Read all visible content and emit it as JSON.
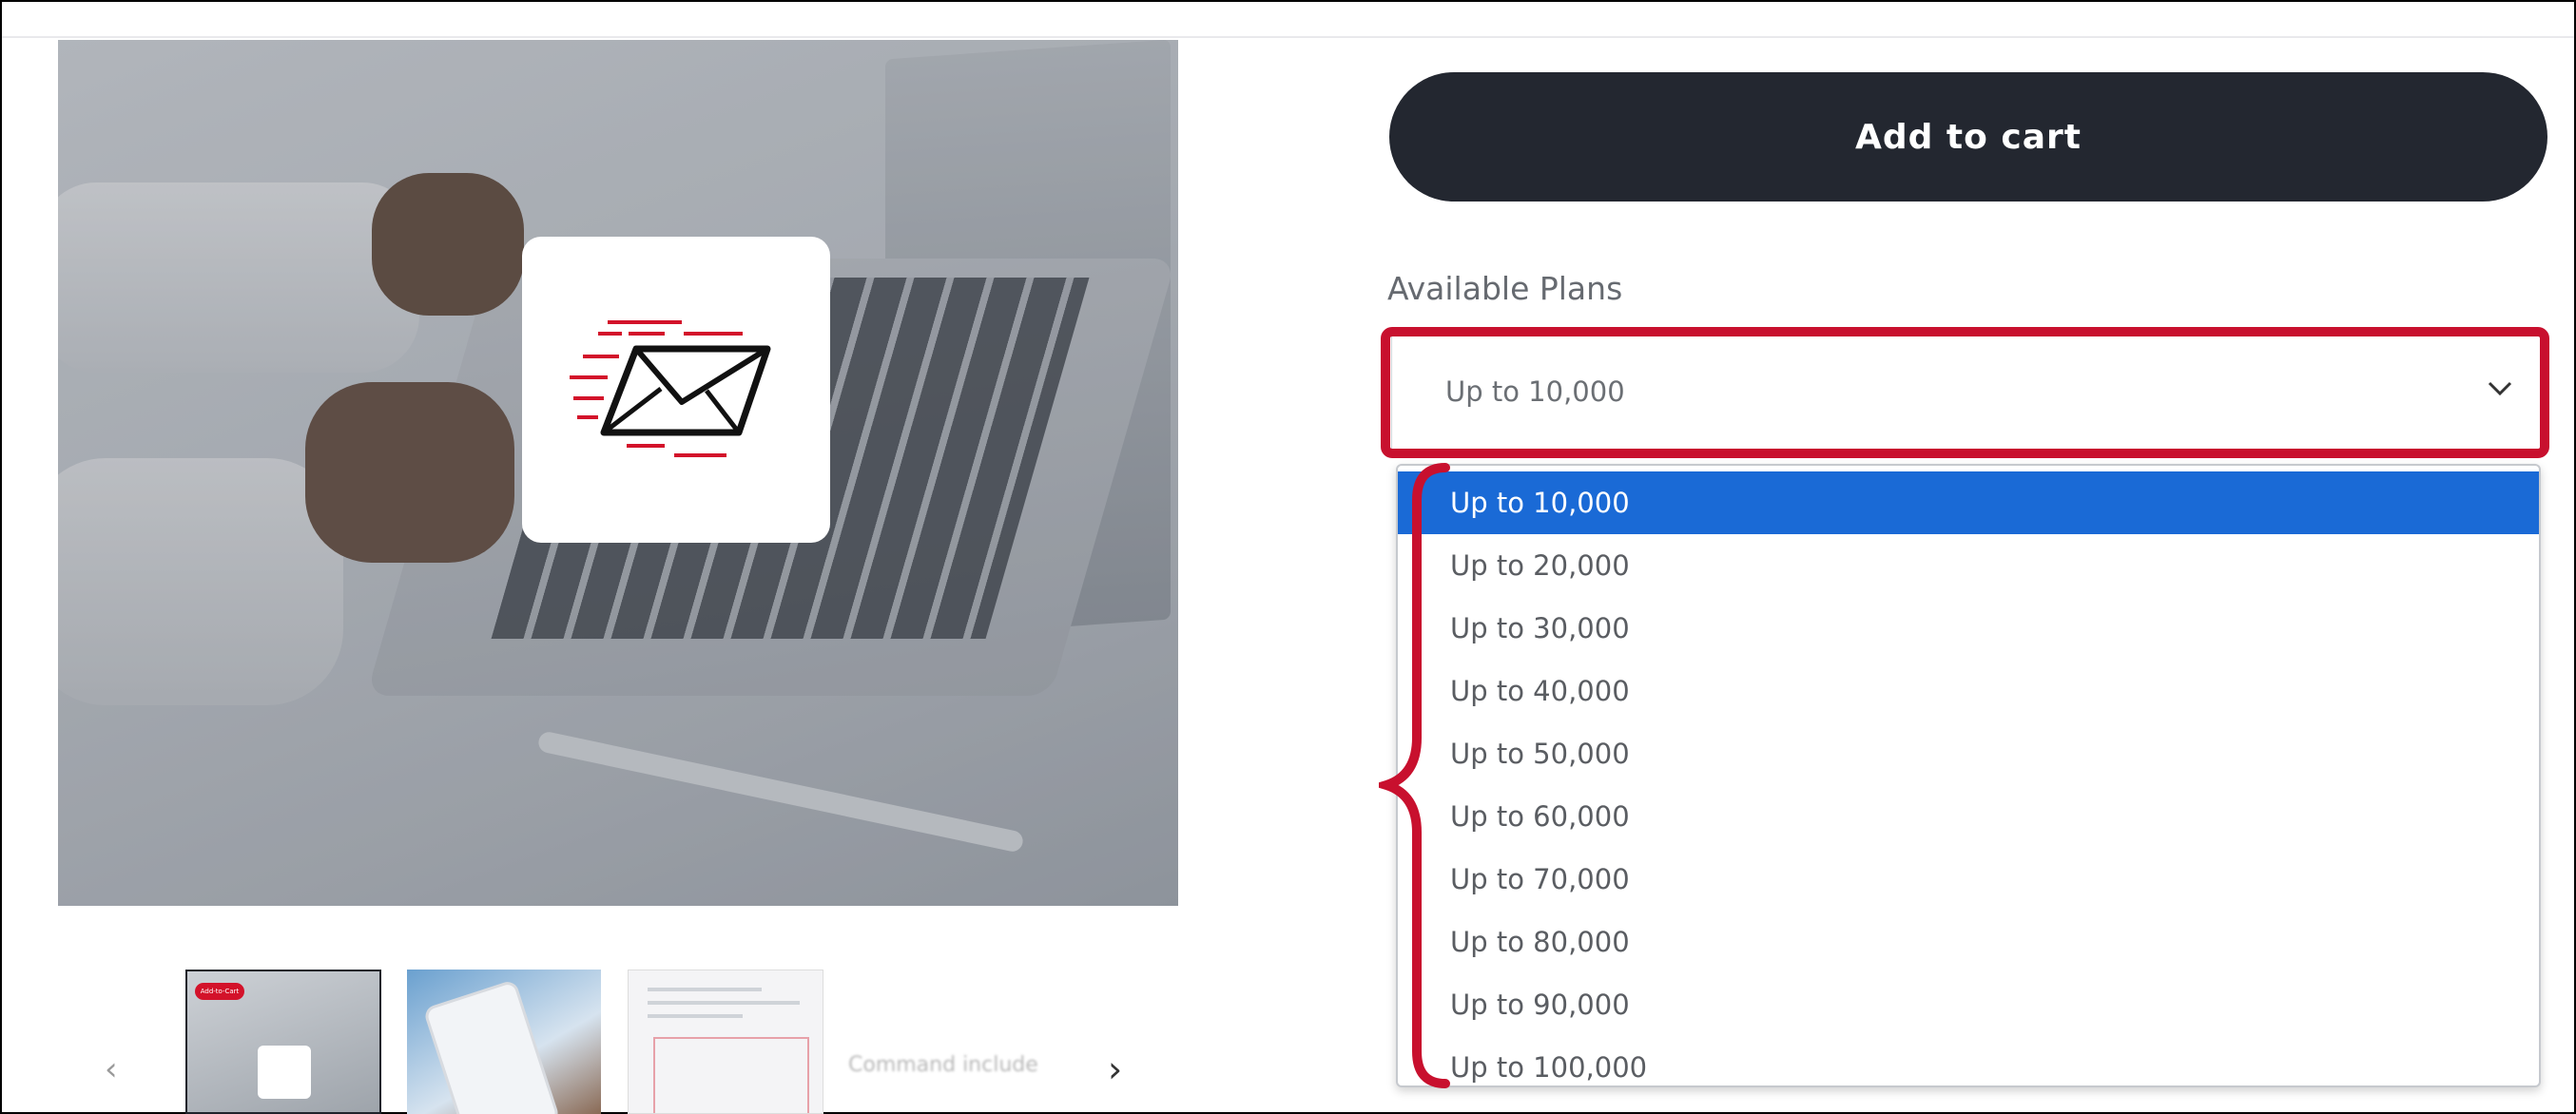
{
  "product": {
    "add_to_cart_label": "Add to cart",
    "plans_label": "Available Plans",
    "selected_plan": "Up to 10,000",
    "thumbnail_caption": "Command include",
    "thumbnail_badge": "Add-to-Cart"
  },
  "dropdown": {
    "options": [
      {
        "label": "Up to 10,000",
        "selected": true
      },
      {
        "label": "Up to 20,000",
        "selected": false
      },
      {
        "label": "Up to 30,000",
        "selected": false
      },
      {
        "label": "Up to 40,000",
        "selected": false
      },
      {
        "label": "Up to 50,000",
        "selected": false
      },
      {
        "label": "Up to 60,000",
        "selected": false
      },
      {
        "label": "Up to 70,000",
        "selected": false
      },
      {
        "label": "Up to 80,000",
        "selected": false
      },
      {
        "label": "Up to 90,000",
        "selected": false
      },
      {
        "label": "Up to 100,000",
        "selected": false
      }
    ]
  },
  "icons": {
    "gallery_prev": "chevron-left-icon",
    "gallery_next": "chevron-right-icon",
    "select_arrow": "chevron-down-icon",
    "product_logo": "email-send-icon"
  },
  "colors": {
    "button_bg": "#232730",
    "highlight": "#c8102e",
    "selected_option": "#1a6ad6"
  }
}
